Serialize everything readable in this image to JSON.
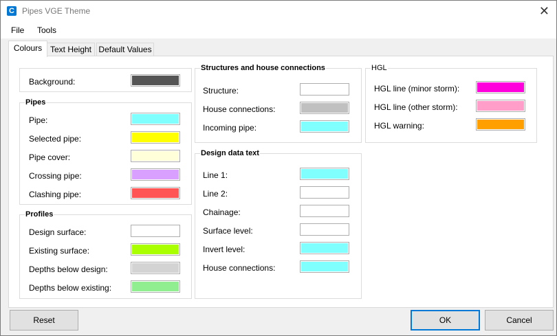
{
  "window": {
    "title": "Pipes VGE Theme",
    "app_icon": "C"
  },
  "menu": {
    "file": "File",
    "tools": "Tools"
  },
  "tabs": [
    "Colours",
    "Text Height",
    "Default Values"
  ],
  "groups": {
    "background": {
      "label": "Background:",
      "color": "#555555"
    },
    "pipes": {
      "title": "Pipes",
      "rows": [
        {
          "label": "Pipe:",
          "color": "#80ffff"
        },
        {
          "label": "Selected pipe:",
          "color": "#ffff00"
        },
        {
          "label": "Pipe cover:",
          "color": "#ffffd9"
        },
        {
          "label": "Crossing pipe:",
          "color": "#d9a0ff"
        },
        {
          "label": "Clashing pipe:",
          "color": "#ff5555"
        }
      ]
    },
    "profiles": {
      "title": "Profiles",
      "rows": [
        {
          "label": "Design surface:",
          "color": "#ffffff"
        },
        {
          "label": "Existing surface:",
          "color": "#aaff00"
        },
        {
          "label": "Depths below design:",
          "color": "#d3d3d3"
        },
        {
          "label": "Depths below existing:",
          "color": "#90ee90"
        }
      ]
    },
    "structures": {
      "title": "Structures and house connections",
      "rows": [
        {
          "label": "Structure:",
          "color": "#ffffff"
        },
        {
          "label": "House connections:",
          "color": "#c0c0c0"
        },
        {
          "label": "Incoming pipe:",
          "color": "#80ffff"
        }
      ]
    },
    "design_text": {
      "title": "Design data text",
      "rows": [
        {
          "label": "Line 1:",
          "color": "#80ffff"
        },
        {
          "label": "Line 2:",
          "color": "#ffffff"
        },
        {
          "label": "Chainage:",
          "color": "#ffffff"
        },
        {
          "label": "Surface level:",
          "color": "#ffffff"
        },
        {
          "label": "Invert level:",
          "color": "#80ffff"
        },
        {
          "label": "House connections:",
          "color": "#80ffff"
        }
      ]
    },
    "hgl": {
      "title": "HGL",
      "rows": [
        {
          "label": "HGL line (minor storm):",
          "color": "#ff00dd"
        },
        {
          "label": "HGL line (other storm):",
          "color": "#ff9ec8"
        },
        {
          "label": "HGL warning:",
          "color": "#ffa000"
        }
      ]
    }
  },
  "buttons": {
    "reset": "Reset",
    "ok": "OK",
    "cancel": "Cancel"
  }
}
